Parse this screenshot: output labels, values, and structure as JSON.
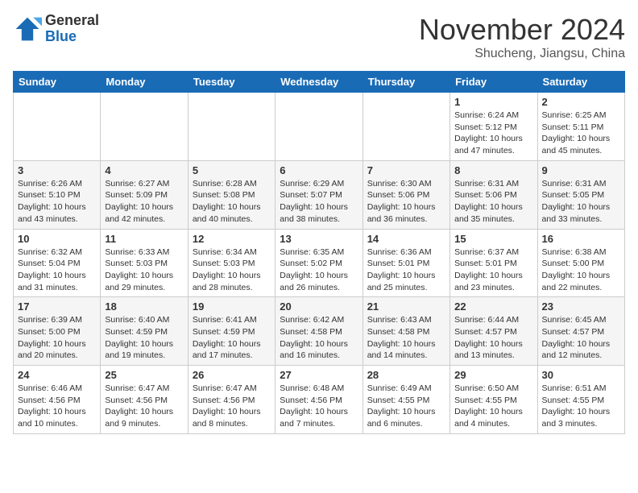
{
  "logo": {
    "general": "General",
    "blue": "Blue"
  },
  "title": "November 2024",
  "location": "Shucheng, Jiangsu, China",
  "days_of_week": [
    "Sunday",
    "Monday",
    "Tuesday",
    "Wednesday",
    "Thursday",
    "Friday",
    "Saturday"
  ],
  "weeks": [
    [
      {
        "day": "",
        "info": ""
      },
      {
        "day": "",
        "info": ""
      },
      {
        "day": "",
        "info": ""
      },
      {
        "day": "",
        "info": ""
      },
      {
        "day": "",
        "info": ""
      },
      {
        "day": "1",
        "info": "Sunrise: 6:24 AM\nSunset: 5:12 PM\nDaylight: 10 hours and 47 minutes."
      },
      {
        "day": "2",
        "info": "Sunrise: 6:25 AM\nSunset: 5:11 PM\nDaylight: 10 hours and 45 minutes."
      }
    ],
    [
      {
        "day": "3",
        "info": "Sunrise: 6:26 AM\nSunset: 5:10 PM\nDaylight: 10 hours and 43 minutes."
      },
      {
        "day": "4",
        "info": "Sunrise: 6:27 AM\nSunset: 5:09 PM\nDaylight: 10 hours and 42 minutes."
      },
      {
        "day": "5",
        "info": "Sunrise: 6:28 AM\nSunset: 5:08 PM\nDaylight: 10 hours and 40 minutes."
      },
      {
        "day": "6",
        "info": "Sunrise: 6:29 AM\nSunset: 5:07 PM\nDaylight: 10 hours and 38 minutes."
      },
      {
        "day": "7",
        "info": "Sunrise: 6:30 AM\nSunset: 5:06 PM\nDaylight: 10 hours and 36 minutes."
      },
      {
        "day": "8",
        "info": "Sunrise: 6:31 AM\nSunset: 5:06 PM\nDaylight: 10 hours and 35 minutes."
      },
      {
        "day": "9",
        "info": "Sunrise: 6:31 AM\nSunset: 5:05 PM\nDaylight: 10 hours and 33 minutes."
      }
    ],
    [
      {
        "day": "10",
        "info": "Sunrise: 6:32 AM\nSunset: 5:04 PM\nDaylight: 10 hours and 31 minutes."
      },
      {
        "day": "11",
        "info": "Sunrise: 6:33 AM\nSunset: 5:03 PM\nDaylight: 10 hours and 29 minutes."
      },
      {
        "day": "12",
        "info": "Sunrise: 6:34 AM\nSunset: 5:03 PM\nDaylight: 10 hours and 28 minutes."
      },
      {
        "day": "13",
        "info": "Sunrise: 6:35 AM\nSunset: 5:02 PM\nDaylight: 10 hours and 26 minutes."
      },
      {
        "day": "14",
        "info": "Sunrise: 6:36 AM\nSunset: 5:01 PM\nDaylight: 10 hours and 25 minutes."
      },
      {
        "day": "15",
        "info": "Sunrise: 6:37 AM\nSunset: 5:01 PM\nDaylight: 10 hours and 23 minutes."
      },
      {
        "day": "16",
        "info": "Sunrise: 6:38 AM\nSunset: 5:00 PM\nDaylight: 10 hours and 22 minutes."
      }
    ],
    [
      {
        "day": "17",
        "info": "Sunrise: 6:39 AM\nSunset: 5:00 PM\nDaylight: 10 hours and 20 minutes."
      },
      {
        "day": "18",
        "info": "Sunrise: 6:40 AM\nSunset: 4:59 PM\nDaylight: 10 hours and 19 minutes."
      },
      {
        "day": "19",
        "info": "Sunrise: 6:41 AM\nSunset: 4:59 PM\nDaylight: 10 hours and 17 minutes."
      },
      {
        "day": "20",
        "info": "Sunrise: 6:42 AM\nSunset: 4:58 PM\nDaylight: 10 hours and 16 minutes."
      },
      {
        "day": "21",
        "info": "Sunrise: 6:43 AM\nSunset: 4:58 PM\nDaylight: 10 hours and 14 minutes."
      },
      {
        "day": "22",
        "info": "Sunrise: 6:44 AM\nSunset: 4:57 PM\nDaylight: 10 hours and 13 minutes."
      },
      {
        "day": "23",
        "info": "Sunrise: 6:45 AM\nSunset: 4:57 PM\nDaylight: 10 hours and 12 minutes."
      }
    ],
    [
      {
        "day": "24",
        "info": "Sunrise: 6:46 AM\nSunset: 4:56 PM\nDaylight: 10 hours and 10 minutes."
      },
      {
        "day": "25",
        "info": "Sunrise: 6:47 AM\nSunset: 4:56 PM\nDaylight: 10 hours and 9 minutes."
      },
      {
        "day": "26",
        "info": "Sunrise: 6:47 AM\nSunset: 4:56 PM\nDaylight: 10 hours and 8 minutes."
      },
      {
        "day": "27",
        "info": "Sunrise: 6:48 AM\nSunset: 4:56 PM\nDaylight: 10 hours and 7 minutes."
      },
      {
        "day": "28",
        "info": "Sunrise: 6:49 AM\nSunset: 4:55 PM\nDaylight: 10 hours and 6 minutes."
      },
      {
        "day": "29",
        "info": "Sunrise: 6:50 AM\nSunset: 4:55 PM\nDaylight: 10 hours and 4 minutes."
      },
      {
        "day": "30",
        "info": "Sunrise: 6:51 AM\nSunset: 4:55 PM\nDaylight: 10 hours and 3 minutes."
      }
    ]
  ]
}
